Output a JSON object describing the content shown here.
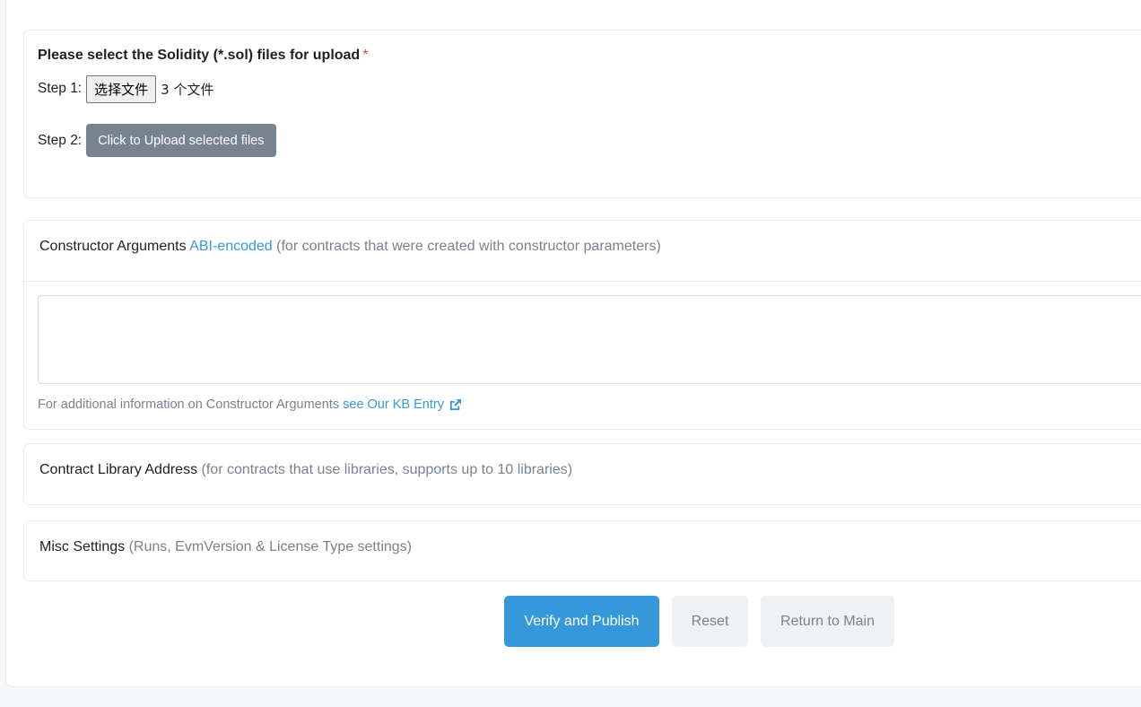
{
  "upload": {
    "title": "Please select the Solidity (*.sol) files for upload",
    "required_mark": "*",
    "step1_label": "Step 1:",
    "choose_file_label": "选择文件",
    "file_status": "3 个文件",
    "step2_label": "Step 2:",
    "upload_button": "Click to Upload selected files"
  },
  "constructor_args": {
    "title": "Constructor Arguments",
    "link": "ABI-encoded",
    "hint": "(for contracts that were created with constructor parameters)",
    "textarea_value": "",
    "note_text": "For additional information on Constructor Arguments",
    "note_link": "see Our KB Entry",
    "note_icon": "external-link-icon"
  },
  "library": {
    "title": "Contract Library Address",
    "hint": "(for contracts that use libraries, supports up to 10 libraries)"
  },
  "misc": {
    "title": "Misc Settings",
    "hint": "(Runs, EvmVersion & License Type settings)"
  },
  "actions": {
    "verify_publish": "Verify and Publish",
    "reset": "Reset",
    "return_main": "Return to Main"
  },
  "colors": {
    "primary": "#3498db",
    "secondary_btn": "#77838f",
    "muted_text": "#77838f",
    "required": "#de4437",
    "border": "#e7eaf3"
  }
}
